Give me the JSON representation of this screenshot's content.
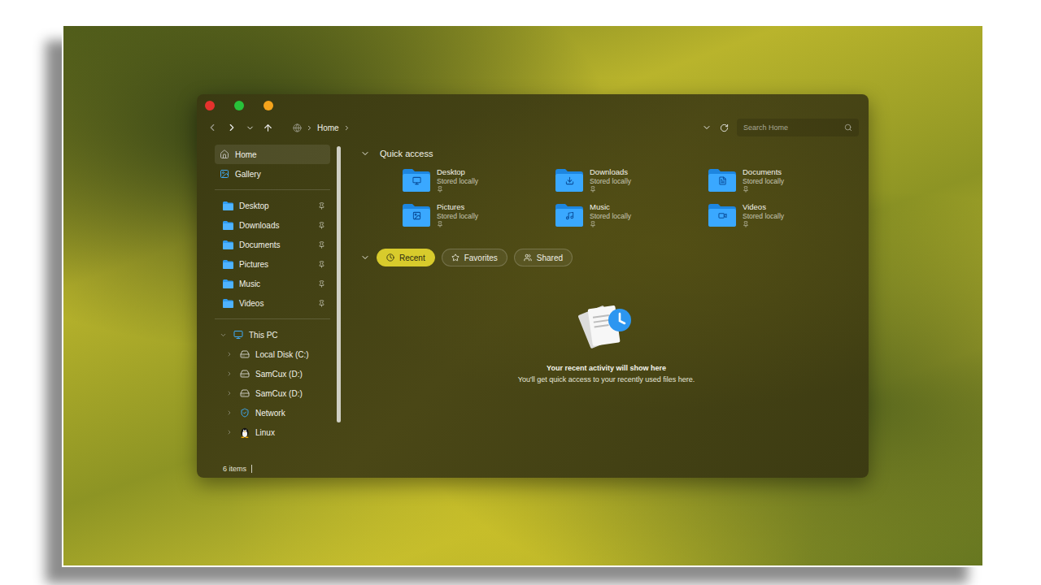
{
  "window": {
    "controls": [
      {
        "color": "#e5322d"
      },
      {
        "color": "#28c13a"
      },
      {
        "color": "#f4a41c"
      }
    ]
  },
  "address_bar": {
    "path": [
      "Home"
    ]
  },
  "search": {
    "placeholder": "Search Home"
  },
  "sidebar": {
    "top": [
      {
        "label": "Home",
        "selected": true
      },
      {
        "label": "Gallery",
        "selected": false
      }
    ],
    "pinned": [
      {
        "label": "Desktop",
        "pinned": true,
        "selected": false
      },
      {
        "label": "Downloads",
        "pinned": true,
        "selected": false
      },
      {
        "label": "Documents",
        "pinned": true,
        "selected": false
      },
      {
        "label": "Pictures",
        "pinned": true,
        "selected": false
      },
      {
        "label": "Music",
        "pinned": true,
        "selected": false
      },
      {
        "label": "Videos",
        "pinned": true,
        "selected": false
      }
    ],
    "tree": {
      "label": "This PC",
      "expanded": true,
      "selected": false,
      "children": [
        {
          "label": "Local Disk (C:)",
          "expanded": false,
          "selected": false
        },
        {
          "label": "SamCux (D:)",
          "expanded": false,
          "selected": false
        },
        {
          "label": "SamCux (D:)",
          "expanded": false,
          "selected": false
        },
        {
          "label": "Network",
          "expanded": false,
          "selected": false
        },
        {
          "label": "Linux",
          "expanded": false,
          "selected": false
        }
      ]
    }
  },
  "status_bar": {
    "count": "6 items"
  },
  "quick_access": {
    "title": "Quick access",
    "expanded": true,
    "items": [
      {
        "name": "Desktop",
        "status": "Stored locally",
        "pinned": true
      },
      {
        "name": "Downloads",
        "status": "Stored locally",
        "pinned": true
      },
      {
        "name": "Documents",
        "status": "Stored locally",
        "pinned": true
      },
      {
        "name": "Pictures",
        "status": "Stored locally",
        "pinned": true
      },
      {
        "name": "Music",
        "status": "Stored locally",
        "pinned": true
      },
      {
        "name": "Videos",
        "status": "Stored locally",
        "pinned": true
      }
    ]
  },
  "recent": {
    "expanded": true,
    "tabs": [
      {
        "label": "Recent",
        "selected": true
      },
      {
        "label": "Favorites",
        "selected": false
      },
      {
        "label": "Shared",
        "selected": false
      }
    ],
    "empty_title": "Your recent activity will show here",
    "empty_text": "You'll get quick access to your recently used files here."
  }
}
